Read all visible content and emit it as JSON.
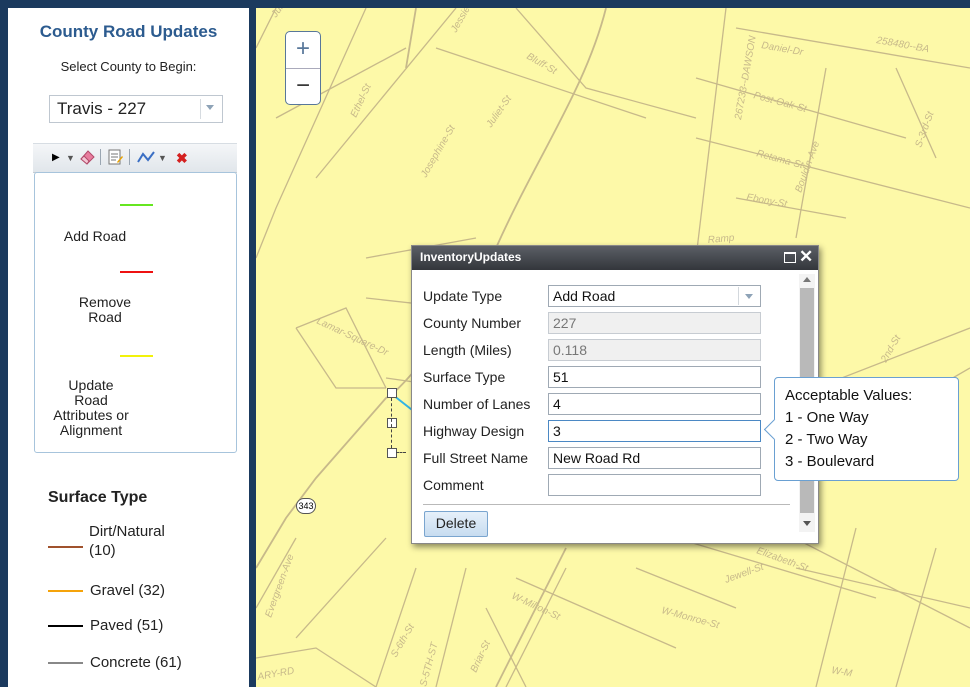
{
  "sidebar": {
    "title": "County Road Updates",
    "select_label": "Select County to Begin:",
    "county_value": "Travis - 227",
    "templates": [
      {
        "label": "Add Road",
        "color": "#66e620"
      },
      {
        "label": "Remove\nRoad",
        "color": "#ee1111"
      },
      {
        "label": "Update\nRoad\nAttributes or\nAlignment",
        "color": "#f2f20a"
      }
    ],
    "legend_title": "Surface Type",
    "legend": [
      {
        "label": "Dirt/Natural\n(10)",
        "color": "#a0522d"
      },
      {
        "label": "Gravel (32)",
        "color": "#f5a30a"
      },
      {
        "label": "Paved (51)",
        "color": "#000000"
      },
      {
        "label": "Concrete (61)",
        "color": "#888888"
      }
    ]
  },
  "map": {
    "zoom_in": "+",
    "zoom_out": "−",
    "highway_shield": "343",
    "street_labels": [
      "Juliet-St",
      "Josephine-St",
      "Ethel-St",
      "Bluff-St",
      "267233--DAWSON",
      "Daniel-Dr",
      "Post-Oak-St",
      "Retama-St",
      "Ebony-St",
      "Bouldin-Ave",
      "258480--BA",
      "S-3rd-St",
      "Lamar-Square-Dr",
      "2nd-St",
      "Elizabeth-St",
      "Jewell-St",
      "W-Milton-St",
      "W-Monroe-St",
      "S-5TH-ST",
      "S-6th-St",
      "Briar-St",
      "Evergreen-Ave",
      "ARY-RD",
      "Ramp"
    ]
  },
  "popup": {
    "title": "InventoryUpdates",
    "fields": [
      {
        "label": "Update Type",
        "value": "Add Road"
      },
      {
        "label": "County Number",
        "value": "227"
      },
      {
        "label": "Length (Miles)",
        "value": "0.118"
      },
      {
        "label": "Surface Type",
        "value": "51"
      },
      {
        "label": "Number of Lanes",
        "value": "4"
      },
      {
        "label": "Highway Design",
        "value": "3"
      },
      {
        "label": "Full Street Name",
        "value": "New Road Rd"
      },
      {
        "label": "Comment",
        "value": ""
      }
    ],
    "delete_label": "Delete"
  },
  "tooltip": {
    "lines": [
      "Acceptable Values:",
      "1 - One Way",
      "2 - Two Way",
      "3 - Boulevard"
    ]
  },
  "colors": {
    "header_blue": "#2c5b8f",
    "map_bg": "#fdf9a8",
    "frame": "#1b3a5e"
  }
}
